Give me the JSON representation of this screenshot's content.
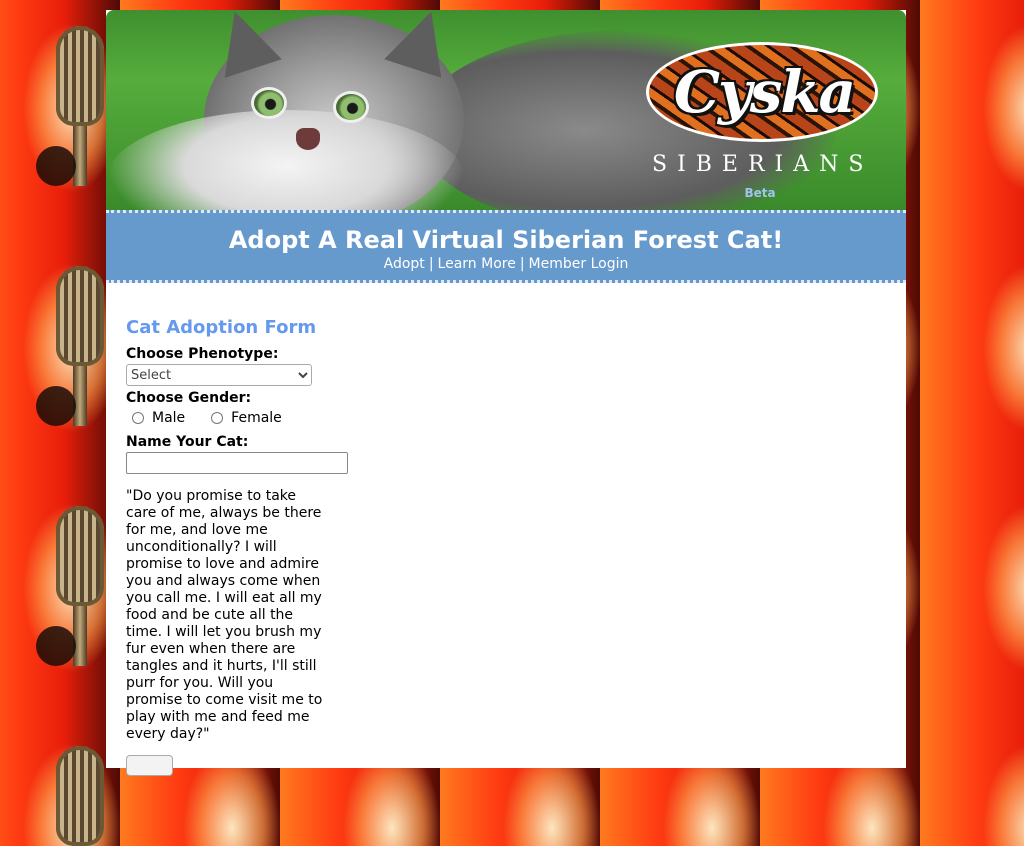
{
  "banner": {
    "logo_word": "Cyska",
    "logo_subtitle": "SIBERIANS",
    "beta_label": "Beta"
  },
  "header": {
    "title": "Adopt A Real Virtual Siberian Forest Cat!",
    "nav": [
      {
        "label": "Adopt"
      },
      {
        "label": "Learn More"
      },
      {
        "label": "Member Login"
      }
    ],
    "separator": "|"
  },
  "form": {
    "title": "Cat Adoption Form",
    "phenotype_label": "Choose Phenotype:",
    "phenotype_selected": "Select",
    "gender_label": "Choose Gender:",
    "gender_options": [
      "Male",
      "Female"
    ],
    "name_label": "Name Your Cat:",
    "name_value": "",
    "promise_text": "\"Do you promise to take care of me, always be there for me, and love me unconditionally? I will promise to love and admire you and always come when you call me. I will eat all my food and be cute all the time. I will let you brush my fur even when there are tangles and it hurts, I'll still purr for you. Will you promise to come visit me to play with me and feed me every day?\""
  },
  "colors": {
    "header_blue": "#6699cc",
    "form_title_blue": "#6699ee",
    "beta_blue": "#9ec6ec",
    "background_red": "#e8481c"
  }
}
